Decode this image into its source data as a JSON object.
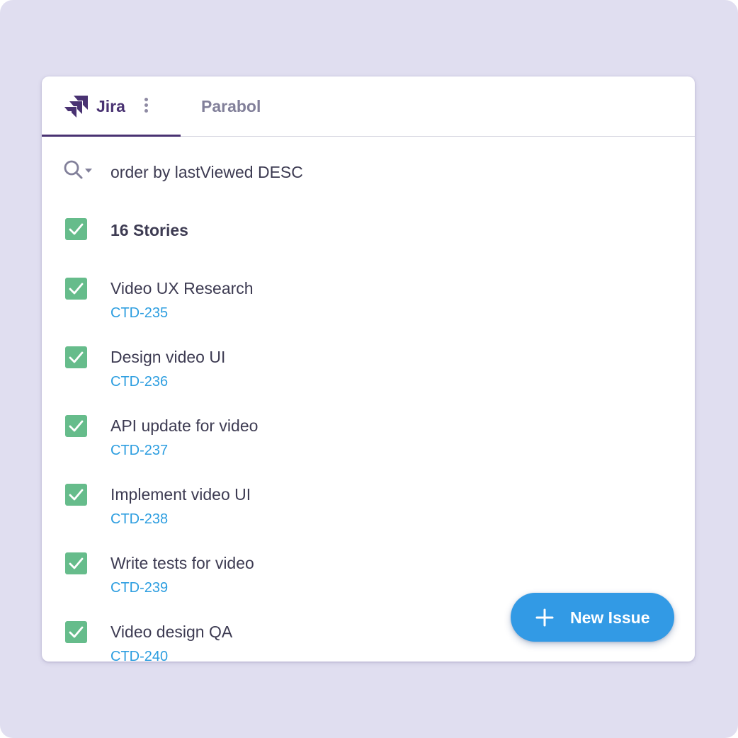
{
  "tabs": {
    "jira_label": "Jira",
    "parabol_label": "Parabol",
    "active": "Jira"
  },
  "search": {
    "query": "order by lastViewed DESC"
  },
  "list_header": {
    "label": "16 Stories",
    "checked": true
  },
  "issues": [
    {
      "title": "Video UX Research",
      "key": "CTD-235",
      "checked": true
    },
    {
      "title": "Design video UI",
      "key": "CTD-236",
      "checked": true
    },
    {
      "title": "API update for video",
      "key": "CTD-237",
      "checked": true
    },
    {
      "title": "Implement video UI",
      "key": "CTD-238",
      "checked": true
    },
    {
      "title": "Write tests for video",
      "key": "CTD-239",
      "checked": true
    },
    {
      "title": "Video design QA",
      "key": "CTD-240",
      "checked": true
    }
  ],
  "fab": {
    "label": "New Issue",
    "icon": "plus-icon"
  },
  "colors": {
    "background": "#e0def0",
    "accent_purple": "#493272",
    "checkbox_green": "#66bc8b",
    "link_blue": "#2d9ee0",
    "fab_blue": "#329ae5"
  }
}
